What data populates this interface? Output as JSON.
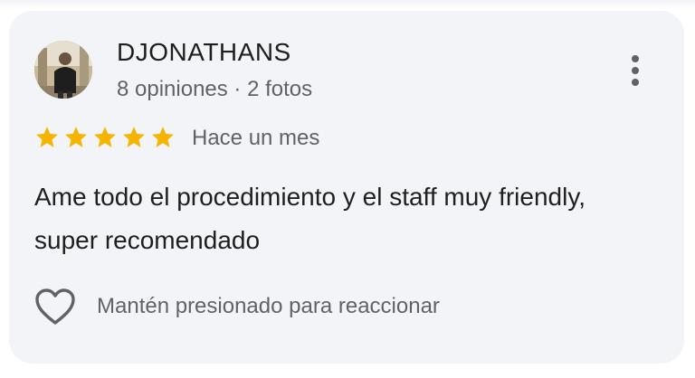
{
  "review": {
    "author_name": "DJONATHANS",
    "author_meta": "8 opiniones · 2 fotos",
    "rating": 5,
    "rating_max": 5,
    "time_ago": "Hace un mes",
    "text": "Ame todo el procedimiento y el staff muy friendly, super recomendado",
    "react_hint": "Mantén presionado para reaccionar"
  },
  "icons": {
    "more": "more-vert-icon",
    "star": "star-icon",
    "heart": "heart-outline-icon"
  },
  "colors": {
    "card_background": "#f3f4f8",
    "star": "#f4b400",
    "primary_text": "#1f1f1f",
    "secondary_text": "#5f6368"
  }
}
